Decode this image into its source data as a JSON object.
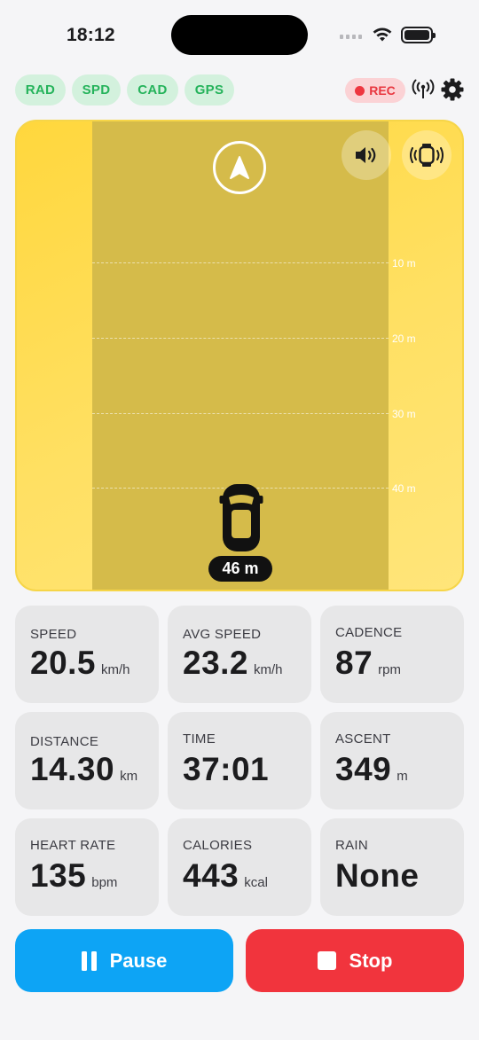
{
  "status": {
    "time": "18:12"
  },
  "sensors": [
    {
      "label": "RAD"
    },
    {
      "label": "SPD"
    },
    {
      "label": "CAD"
    },
    {
      "label": "GPS"
    }
  ],
  "recording": {
    "label": "REC"
  },
  "radar": {
    "grid_labels": [
      "10 m",
      "20 m",
      "30 m",
      "40 m"
    ],
    "vehicle_distance": "46 m"
  },
  "metrics": [
    {
      "label": "SPEED",
      "value": "20.5",
      "unit": "km/h"
    },
    {
      "label": "AVG SPEED",
      "value": "23.2",
      "unit": "km/h"
    },
    {
      "label": "CADENCE",
      "value": "87",
      "unit": "rpm"
    },
    {
      "label": "DISTANCE",
      "value": "14.30",
      "unit": "km"
    },
    {
      "label": "TIME",
      "value": "37:01",
      "unit": ""
    },
    {
      "label": "ASCENT",
      "value": "349",
      "unit": "m"
    },
    {
      "label": "HEART RATE",
      "value": "135",
      "unit": "bpm"
    },
    {
      "label": "CALORIES",
      "value": "443",
      "unit": "kcal"
    },
    {
      "label": "RAIN",
      "value": "None",
      "unit": ""
    }
  ],
  "actions": {
    "pause_label": "Pause",
    "stop_label": "Stop"
  },
  "colors": {
    "sensor_ok": "#25b35b",
    "rec": "#e8363f",
    "radar_bg": "#ffd73d",
    "pause": "#0da4f5",
    "stop": "#f1343d"
  },
  "icons": {
    "compass": "compass-arrow-icon",
    "sound": "speaker-icon",
    "watch": "watch-vibrate-icon",
    "antenna": "antenna-icon",
    "settings": "gear-icon"
  }
}
